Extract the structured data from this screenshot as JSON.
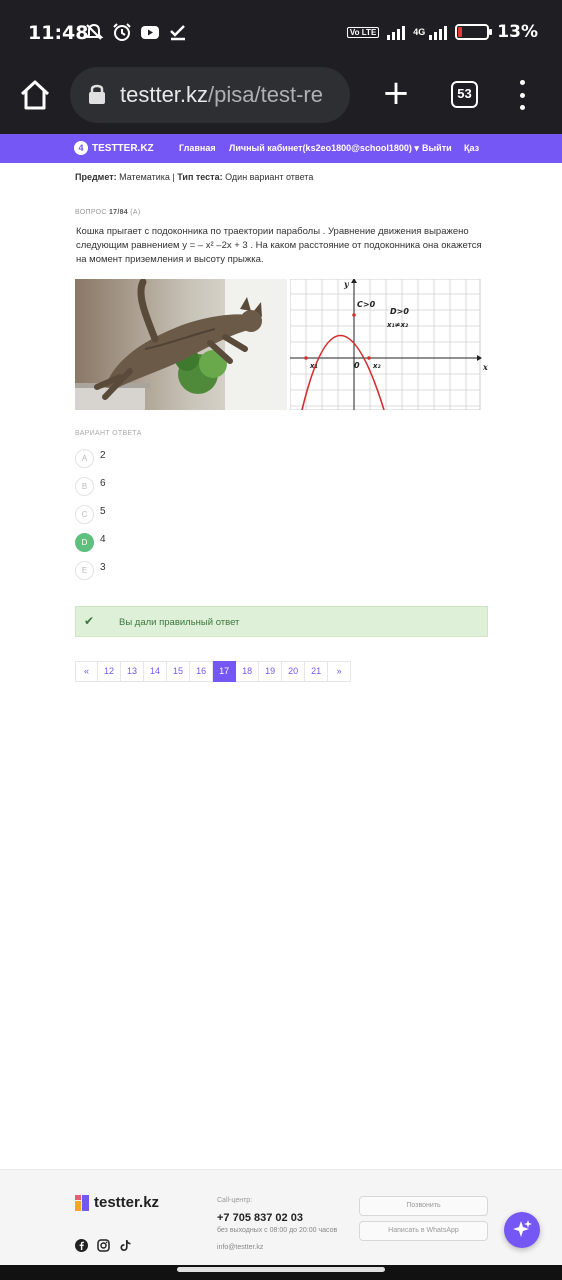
{
  "status_bar": {
    "time": "11:48",
    "volte_label": "Vo LTE",
    "network_label": "4G",
    "battery_percent": "13%",
    "battery_level": 0.13,
    "icons": [
      "mute-icon",
      "alarm-icon",
      "youtube-icon",
      "check-icon"
    ]
  },
  "browser": {
    "url_host": "testter.kz",
    "url_path": "/pisa/test-re",
    "tab_count": "53"
  },
  "site_nav": {
    "logo_text": "TESTTER.KZ",
    "logo_mark": "4",
    "items": [
      {
        "label": "Главная"
      },
      {
        "label": "Личный кабинет(ks2eo1800@school1800) ▾"
      },
      {
        "label": "Выйти"
      },
      {
        "label": "Қаз"
      }
    ]
  },
  "test_info": {
    "subject_label": "Предмет:",
    "subject_value": "Математика",
    "separator": "|",
    "type_label": "Тип теста:",
    "type_value": "Один вариант ответа"
  },
  "question": {
    "prefix": "ВОПРОС",
    "number": "17/84",
    "variant": "(A)",
    "text": "Кошка прыгает с подоконника по траектории параболы . Уравнение движения выражено следующим равнением у = – х² –2х + 3 . На каком расстояние от подоконника она окажется на момент приземления и высоту прыжка."
  },
  "graph": {
    "label_y": "y",
    "label_x": "x",
    "label_c": "C>0",
    "label_d": "D>0",
    "label_x_rel": "x₁≠x₂",
    "label_zero": "0",
    "label_x1": "x₁",
    "label_x2": "x₂",
    "curve_color": "#d32f2f"
  },
  "answers": {
    "label": "ВАРИАНТ ОТВЕТА",
    "options": [
      {
        "letter": "A",
        "value": "2"
      },
      {
        "letter": "B",
        "value": "6"
      },
      {
        "letter": "C",
        "value": "5"
      },
      {
        "letter": "D",
        "value": "4"
      },
      {
        "letter": "E",
        "value": "3"
      }
    ],
    "selected": "D"
  },
  "result": {
    "message": "Вы дали правильный ответ"
  },
  "pagination": {
    "prev": "«",
    "pages": [
      "12",
      "13",
      "14",
      "15",
      "16",
      "17",
      "18",
      "19",
      "20",
      "21"
    ],
    "current": "17",
    "next": "»"
  },
  "footer": {
    "logo_text": "testter.kz",
    "callcenter_label": "Call-центр:",
    "phone": "+7 705 837 02 03",
    "hours": "без выходных с 08:00 до 20:00 часов",
    "email": "info@testter.kz",
    "call_button": "Позвонить",
    "whatsapp_button": "Написать в WhatsApp",
    "social_icons": [
      "facebook-icon",
      "instagram-icon",
      "tiktok-icon"
    ]
  },
  "colors": {
    "brand": "#7557f6",
    "correct": "#5fbf7f",
    "success_bg": "#dff0d8",
    "success_text": "#3c763d"
  }
}
